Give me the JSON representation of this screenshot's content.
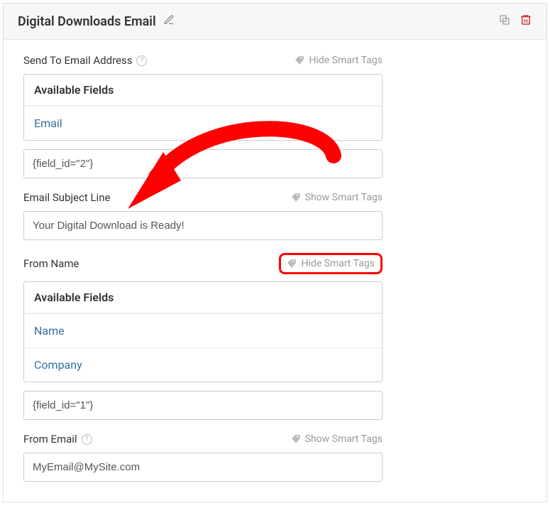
{
  "header": {
    "title": "Digital Downloads Email"
  },
  "sendTo": {
    "label": "Send To Email Address",
    "smartTagsLabel": "Hide Smart Tags",
    "availableTitle": "Available Fields",
    "availableItems": [
      "Email"
    ],
    "value": "{field_id=\"2\"}"
  },
  "subject": {
    "label": "Email Subject Line",
    "smartTagsLabel": "Show Smart Tags",
    "value": "Your Digital Download is Ready!"
  },
  "fromName": {
    "label": "From Name",
    "smartTagsLabel": "Hide Smart Tags",
    "availableTitle": "Available Fields",
    "availableItems": [
      "Name",
      "Company"
    ],
    "value": "{field_id=\"1\"}"
  },
  "fromEmail": {
    "label": "From Email",
    "smartTagsLabel": "Show Smart Tags",
    "value": "MyEmail@MySite.com"
  }
}
